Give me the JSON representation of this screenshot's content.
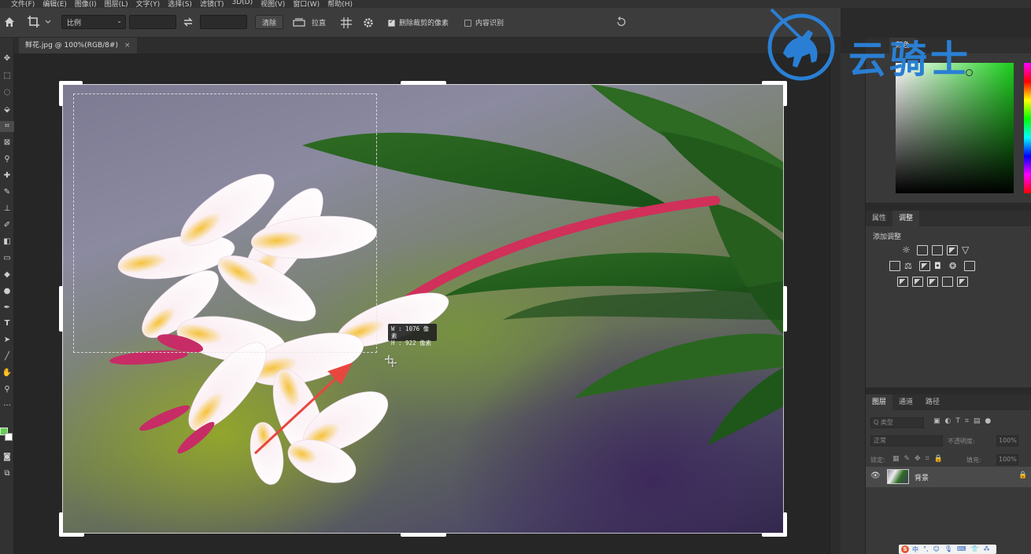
{
  "menu": [
    "文件(F)",
    "编辑(E)",
    "图像(I)",
    "图层(L)",
    "文字(Y)",
    "选择(S)",
    "滤镜(T)",
    "3D(D)",
    "视图(V)",
    "窗口(W)",
    "帮助(H)"
  ],
  "options": {
    "ratio_select": "比例",
    "clear_label": "清除",
    "straighten_label": "拉直",
    "delete_cropped_label": "删除裁剪的像素",
    "delete_cropped_checked": true,
    "content_aware_label": "内容识别",
    "content_aware_checked": false
  },
  "document": {
    "tab_title": "鲜花.jpg @ 100%(RGB/8#)",
    "close": "×"
  },
  "crop_tooltip": {
    "width": "W : 1076 像素",
    "height": "H :  922 像素"
  },
  "panels": {
    "color_tab_partial": "颜色",
    "properties_tab": "属性",
    "adjustments_tab": "调整",
    "add_adjustment": "添加调整",
    "layers_tab": "图层",
    "channels_tab": "通道",
    "paths_tab": "路径",
    "filter_kind": "Q 类型",
    "blend_mode": "正常",
    "opacity_label": "不透明度:",
    "opacity_value": "100%",
    "lock_label": "锁定:",
    "fill_label": "填充:",
    "fill_value": "100%",
    "layer_name": "背景"
  },
  "watermark": {
    "text": "云骑士"
  },
  "tray": {
    "items": [
      "中",
      "°,",
      "☺",
      "🎙",
      "⌨",
      "👕",
      "⁂"
    ]
  },
  "colors": {
    "foreground": "#5fd14a",
    "accent_logo": "#2a7fd4",
    "annotation_arrow": "#e8473f"
  }
}
